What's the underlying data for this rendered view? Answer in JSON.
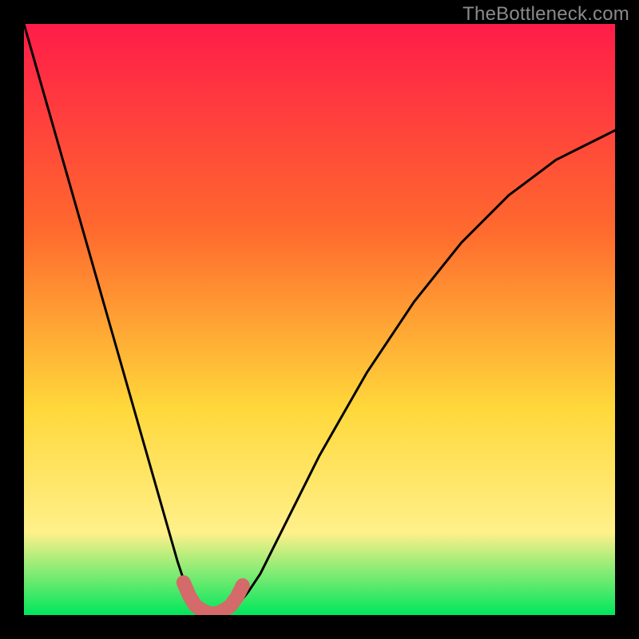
{
  "watermark": "TheBottleneck.com",
  "colors": {
    "frame": "#000000",
    "grad_top": "#ff1c49",
    "grad_mid1": "#ff6a2e",
    "grad_mid2": "#ffd83a",
    "grad_mid3": "#fff08a",
    "grad_bottom": "#00e65c",
    "curve": "#000000",
    "marker": "#d46a6a"
  },
  "chart_data": {
    "type": "line",
    "title": "",
    "xlabel": "",
    "ylabel": "",
    "xlim": [
      0,
      100
    ],
    "ylim": [
      0,
      100
    ],
    "x": [
      0,
      2,
      4,
      6,
      8,
      10,
      12,
      14,
      16,
      18,
      20,
      22,
      24,
      26,
      27,
      28,
      29,
      30,
      31,
      32,
      33,
      34,
      35,
      36,
      38,
      40,
      42,
      44,
      46,
      48,
      50,
      54,
      58,
      62,
      66,
      70,
      74,
      78,
      82,
      86,
      90,
      94,
      98,
      100
    ],
    "y": [
      100,
      93,
      86,
      79,
      72,
      65,
      58,
      51,
      44,
      37,
      30,
      23,
      16,
      9,
      6,
      3,
      1.5,
      0.8,
      0.4,
      0.2,
      0.2,
      0.4,
      0.8,
      1.5,
      4,
      7,
      11,
      15,
      19,
      23,
      27,
      34,
      41,
      47,
      53,
      58,
      63,
      67,
      71,
      74,
      77,
      79,
      81,
      82
    ],
    "optimum_x": 32,
    "marker_segment_x": [
      27,
      28,
      29,
      30,
      31,
      32,
      33,
      34,
      35,
      36,
      37
    ],
    "marker_segment_y": [
      5.5,
      3.2,
      1.6,
      0.9,
      0.4,
      0.2,
      0.4,
      0.9,
      1.6,
      3.0,
      5.0
    ]
  }
}
